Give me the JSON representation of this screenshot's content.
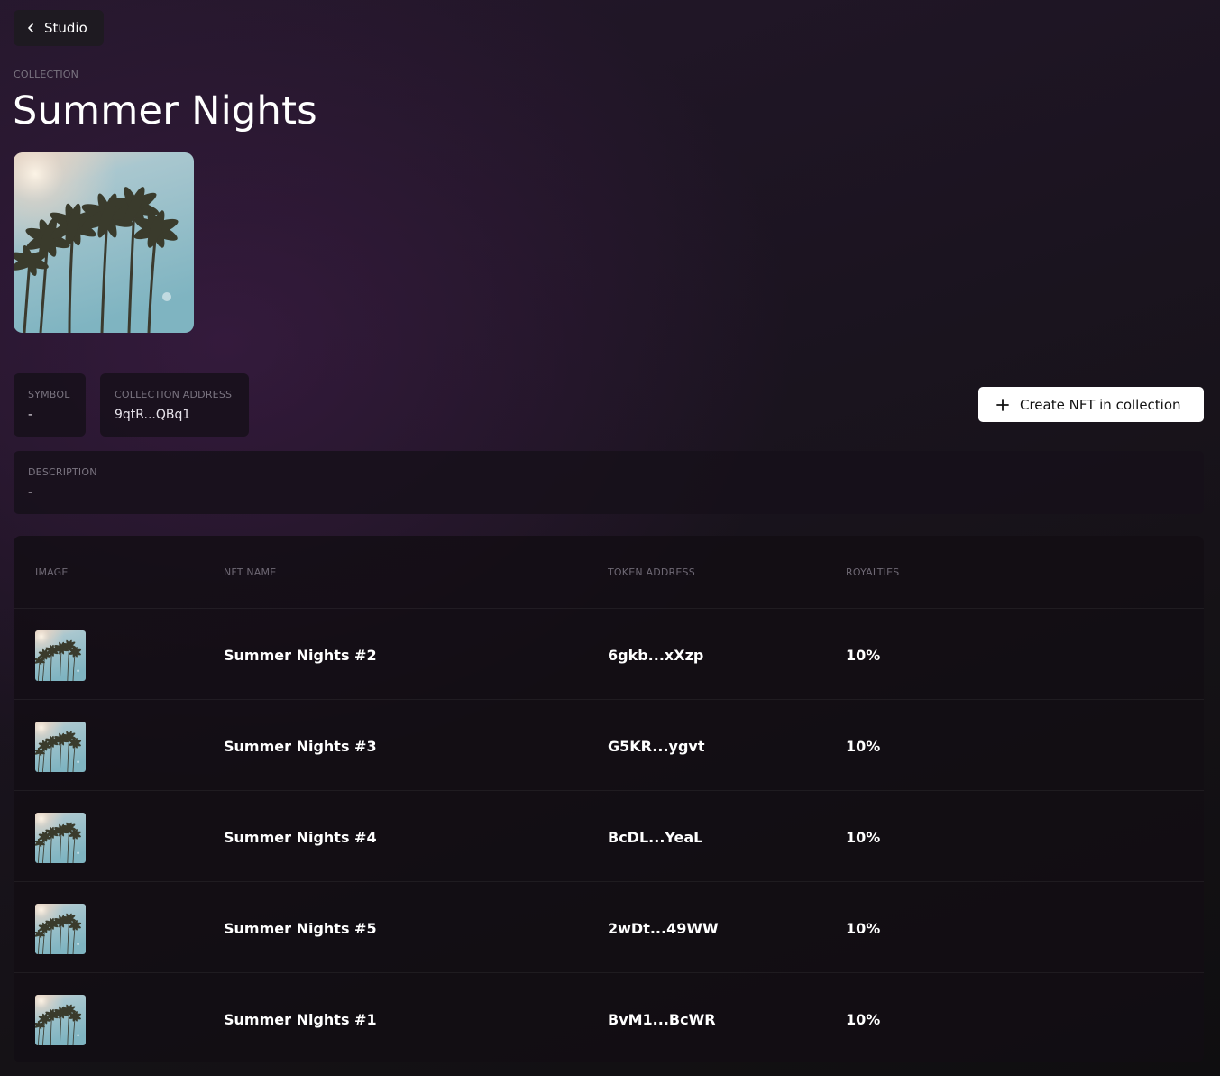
{
  "nav": {
    "back_label": "Studio"
  },
  "collection": {
    "eyebrow": "COLLECTION",
    "title": "Summer Nights",
    "symbol_label": "SYMBOL",
    "symbol_value": "-",
    "address_label": "COLLECTION ADDRESS",
    "address_value": "9qtR...QBq1",
    "description_label": "DESCRIPTION",
    "description_value": "-"
  },
  "actions": {
    "create_label": "Create NFT in collection"
  },
  "table": {
    "headers": {
      "image": "IMAGE",
      "name": "NFT NAME",
      "address": "TOKEN ADDRESS",
      "royalties": "ROYALTIES"
    },
    "rows": [
      {
        "name": "Summer Nights #2",
        "address": "6gkb...xXzp",
        "royalties": "10%"
      },
      {
        "name": "Summer Nights #3",
        "address": "G5KR...ygvt",
        "royalties": "10%"
      },
      {
        "name": "Summer Nights #4",
        "address": "BcDL...YeaL",
        "royalties": "10%"
      },
      {
        "name": "Summer Nights #5",
        "address": "2wDt...49WW",
        "royalties": "10%"
      },
      {
        "name": "Summer Nights #1",
        "address": "BvM1...BcWR",
        "royalties": "10%"
      }
    ]
  },
  "colors": {
    "background": "#141216",
    "accent_button": "#ffffff",
    "muted_text": "#7a7480"
  }
}
